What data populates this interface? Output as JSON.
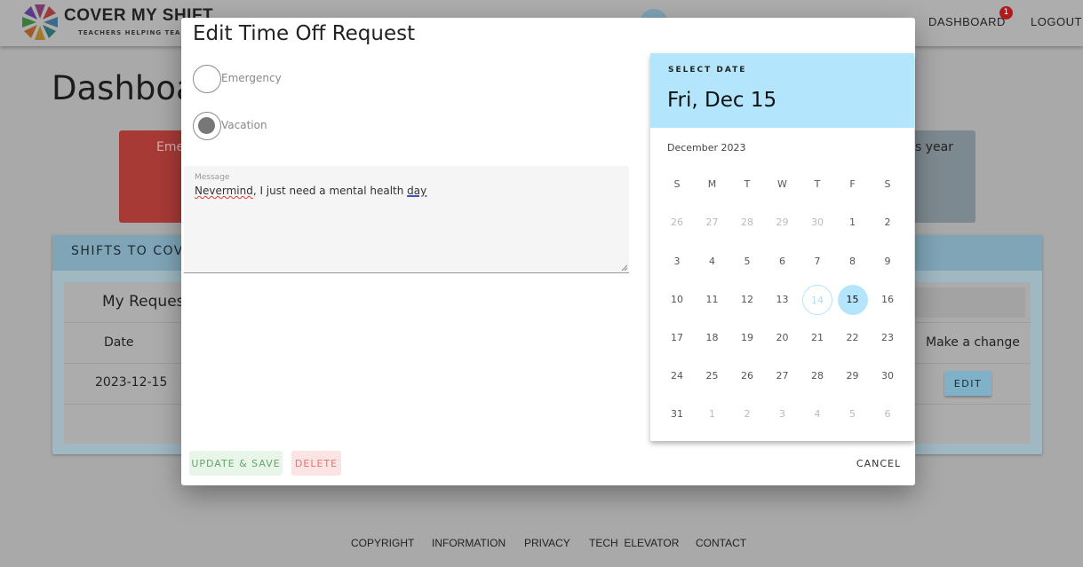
{
  "header": {
    "brand": "COVER MY SHIFT",
    "tagline": "TEACHERS HELPING TEA",
    "nav": [
      {
        "label": "DASHBOARD",
        "badge": "1"
      },
      {
        "label": "LOGOUT"
      }
    ]
  },
  "page": {
    "title": "Dashboard"
  },
  "cards": {
    "red_fragment": "Eme",
    "red_color": "#a83a36",
    "gray_fragment": "s year"
  },
  "panel": {
    "header_fragment": "SHIFTS TO COVE",
    "table_title_fragment": "My Reques",
    "columns": [
      "Date",
      "Make a change"
    ],
    "rows": [
      {
        "date": "2023-12-15",
        "action": "EDIT"
      }
    ]
  },
  "footer": {
    "links": [
      "COPYRIGHT",
      "INFORMATION",
      "PRIVACY",
      "TECH  ELEVATOR",
      "CONTACT"
    ]
  },
  "dialog": {
    "title": "Edit Time Off Request",
    "options": [
      {
        "label": "Emergency",
        "selected": false
      },
      {
        "label": "Vacation",
        "selected": true
      }
    ],
    "message": {
      "label": "Message",
      "value_spell": "Nevermind",
      "value_mid": ", I just need a mental health ",
      "value_grammar": "day"
    },
    "buttons": {
      "save": "UPDATE & SAVE",
      "delete": "DELETE",
      "cancel": "CANCEL"
    },
    "calendar": {
      "select_label": "SELECT DATE",
      "selected_display": "Fri, Dec 15",
      "month": "December 2023",
      "weekdays": [
        "S",
        "M",
        "T",
        "W",
        "T",
        "F",
        "S"
      ],
      "weeks": [
        [
          "26",
          "27",
          "28",
          "29",
          "30",
          "1",
          "2"
        ],
        [
          "3",
          "4",
          "5",
          "6",
          "7",
          "8",
          "9"
        ],
        [
          "10",
          "11",
          "12",
          "13",
          "14",
          "15",
          "16"
        ],
        [
          "17",
          "18",
          "19",
          "20",
          "21",
          "22",
          "23"
        ],
        [
          "24",
          "25",
          "26",
          "27",
          "28",
          "29",
          "30"
        ],
        [
          "31",
          "1",
          "2",
          "3",
          "4",
          "5",
          "6"
        ]
      ],
      "today": "14",
      "selected": "15",
      "accent": "#b3e5fc"
    }
  }
}
